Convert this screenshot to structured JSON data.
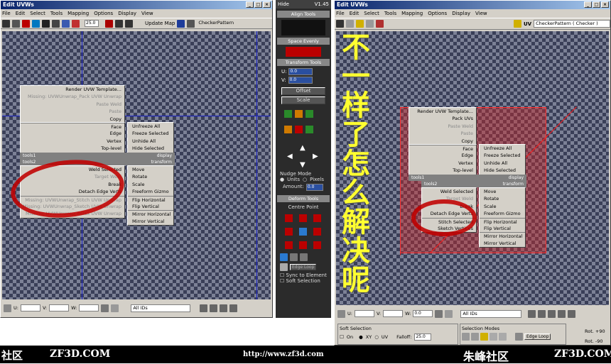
{
  "left": {
    "title": "Edit UVWs",
    "menus": [
      "File",
      "Edit",
      "Select",
      "Tools",
      "Mapping",
      "Options",
      "Display",
      "View"
    ],
    "spin_value": "25.0",
    "update_map": "Update Map",
    "texture": "CheckerPattern",
    "ctx_top": [
      "Render UVW Template...",
      "Missing: UVWUnwrap_Pack UVW Unwrap",
      "Paste Weld",
      "Paste",
      "Copy"
    ],
    "ctx_mid": [
      "Face",
      "Edge",
      "Vertex",
      "Top-level"
    ],
    "ctx_mid_right": [
      "Unfreeze All",
      "Freeze Selected",
      "Unhide All",
      "Hide Selected"
    ],
    "hdr1_l": "tools1",
    "hdr1_r": "display",
    "hdr2_l": "tools2",
    "hdr2_r": "transform",
    "ctx_low": [
      "Weld Selected",
      "Target Weld",
      "Break",
      "Detach Edge Verts",
      "Missing: UVWUnwrap_Stitch UVW Unwrap",
      "Missing: UVWUnwrap_Sketch UVW Unwrap",
      "Missing: UVWUnwrap_Relax UVW Unwrap"
    ],
    "ctx_low_right": [
      "Move",
      "Rotate",
      "Scale",
      "Freeform Gizmo",
      "Flip Horizontal",
      "Flip Vertical",
      "Mirror Horizontal",
      "Mirror Vertical"
    ],
    "u_label": "U:",
    "v_label": "V:",
    "w_label": "W:",
    "ids": "All IDs"
  },
  "panel": {
    "hide": "Hide",
    "version": "V1.45",
    "align": "Align Tools",
    "space": "Space Evenly",
    "transform": "Transform Tools",
    "u": "U:",
    "v": "V:",
    "uval": "0.0",
    "vval": "0.0",
    "offset": "Offset",
    "scale": "Scale",
    "nudge": "Nudge Mode",
    "units": "Units",
    "pixels": "Pixels",
    "amount": "Amount:",
    "amount_val": "0.0",
    "deform": "Deform Tools",
    "centre": "Centre Point",
    "edge_loop": "Edge Loop",
    "sync": "Sync to Element",
    "soft": "Soft Selection"
  },
  "right": {
    "title": "Edit UVWs",
    "menus": [
      "File",
      "Edit",
      "Select",
      "Tools",
      "Mapping",
      "Options",
      "Display",
      "View"
    ],
    "uv": "UV",
    "texture": "CheckerPattern ( Checker )",
    "ctx_top": [
      "Render UVW Template...",
      "Pack UVs",
      "Paste Weld",
      "Paste",
      "Copy"
    ],
    "ctx_mid": [
      "Face",
      "Edge",
      "Vertex",
      "Top-level"
    ],
    "ctx_mid_right": [
      "Unfreeze All",
      "Freeze Selected",
      "Unhide All",
      "Hide Selected"
    ],
    "hdr1_l": "tools1",
    "hdr1_r": "display",
    "hdr2_l": "tools2",
    "hdr2_r": "transform",
    "ctx_low": [
      "Weld Selected",
      "Target Weld",
      "Break",
      "Detach Edge Verts",
      "Stitch Selected",
      "Sketch Vertices"
    ],
    "ctx_low_right": [
      "Move",
      "Rotate",
      "Scale",
      "Freeform Gizmo",
      "Flip Horizontal",
      "Flip Vertical",
      "Mirror Horizontal",
      "Mirror Vertical"
    ],
    "u_label": "U:",
    "v_label": "V:",
    "w_label": "W:",
    "u_val": "",
    "v_val": "",
    "w_val": "0.0",
    "ids": "All IDs",
    "soft_sel": "Soft Selection",
    "on": "On",
    "xy": "XY",
    "uv2": "UV",
    "falloff": "Falloff:",
    "falloff_val": "25.0",
    "sel_modes": "Selection Modes",
    "edge_loop": "Edge Loop",
    "rot90": "Rot. +90",
    "rotm90": "Rot. -90"
  },
  "annotation": "不一样了怎么解决呢",
  "footer": {
    "l1": "社区",
    "l2": "ZF3D.COM",
    "mid": "http://www.zf3d.com",
    "r1": "朱峰社区",
    "r2": "ZF3D.COM"
  }
}
